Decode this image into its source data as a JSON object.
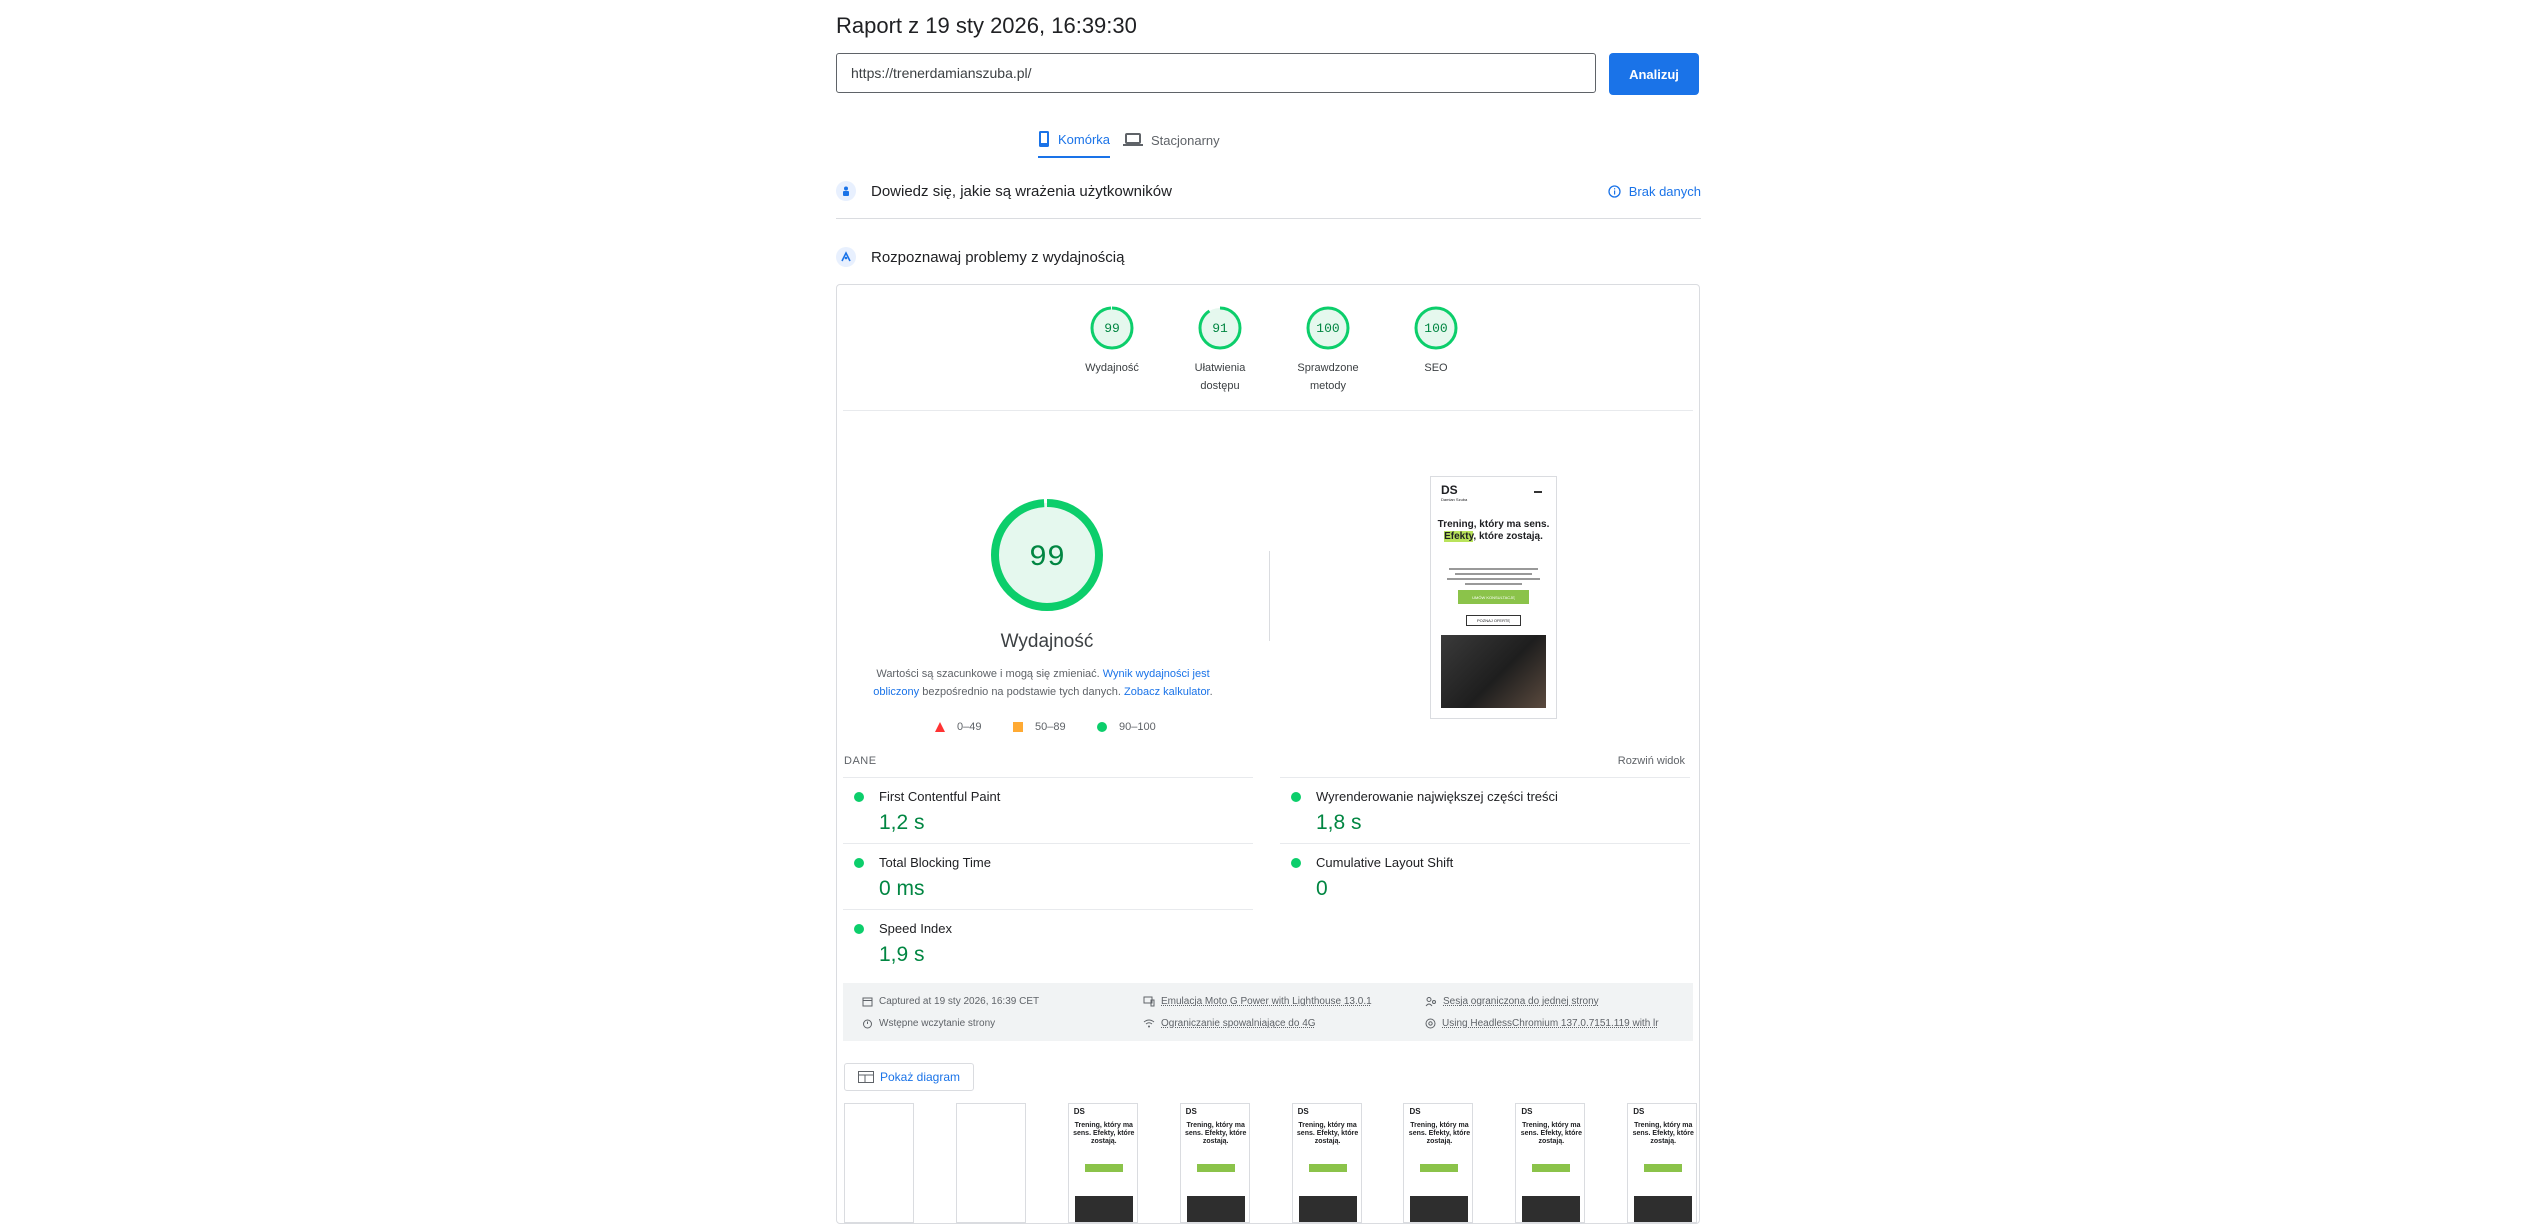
{
  "report": {
    "title": "Raport z 19 sty 2026, 16:39:30",
    "url_value": "https://trenerdamianszuba.pl/",
    "analyze_label": "Analizuj"
  },
  "tabs": [
    {
      "label": "Komórka",
      "active": true,
      "icon": "mobile-icon"
    },
    {
      "label": "Stacjonarny",
      "active": false,
      "icon": "laptop-icon"
    }
  ],
  "field_section": {
    "title": "Dowiedz się, jakie są wrażenia użytkowników",
    "no_data_label": "Brak danych"
  },
  "lab_section": {
    "title": "Rozpoznawaj problemy z wydajnością"
  },
  "scores": [
    {
      "value": 99,
      "label_line1": "Wydajność",
      "label_line2": ""
    },
    {
      "value": 91,
      "label_line1": "Ułatwienia",
      "label_line2": "dostępu"
    },
    {
      "value": 100,
      "label_line1": "Sprawdzone",
      "label_line2": "metody"
    },
    {
      "value": 100,
      "label_line1": "SEO",
      "label_line2": ""
    }
  ],
  "performance": {
    "score": 99,
    "label": "Wydajność",
    "note_before": "Wartości są szacunkowe i mogą się zmieniać. ",
    "note_link1": "Wynik wydajności jest obliczony",
    "note_middle": " bezpośrednio na podstawie tych danych. ",
    "note_link2": "Zobacz kalkulator",
    "note_end": ".",
    "legend": [
      {
        "range": "0–49",
        "color": "#ff3333",
        "shape": "triangle"
      },
      {
        "range": "50–89",
        "color": "#ffaa33",
        "shape": "square"
      },
      {
        "range": "90–100",
        "color": "#0cce6b",
        "shape": "circle"
      }
    ]
  },
  "screenshot": {
    "logo": "DS",
    "logo_sub": "Damian Szuba",
    "headline_pre": "Trening, który ma sens. ",
    "headline_highlight": "Efekty",
    "headline_post": ", które zostają.",
    "cta": "UMÓW KONSULTACJĘ",
    "secondary": "POZNAJ OFERTĘ"
  },
  "metrics": {
    "header": "DANE",
    "expand_label": "Rozwiń widok",
    "items": [
      {
        "name": "First Contentful Paint",
        "value": "1,2 s"
      },
      {
        "name": "Wyrenderowanie największej części treści",
        "value": "1,8 s"
      },
      {
        "name": "Total Blocking Time",
        "value": "0 ms"
      },
      {
        "name": "Cumulative Layout Shift",
        "value": "0"
      },
      {
        "name": "Speed Index",
        "value": "1,9 s"
      }
    ]
  },
  "run_info": {
    "captured": "Captured at 19 sty 2026, 16:39 CET",
    "load": "Wstępne wczytanie strony",
    "emulation": "Emulacja Moto G Power with Lighthouse 13.0.1",
    "throttling": "Ograniczanie spowalniające do 4G",
    "session": "Sesja ograniczona do jednej strony",
    "browser": "Using HeadlessChromium 137.0.7151.119 with lr"
  },
  "diagram_label": "Pokaż diagram",
  "filmstrip": {
    "blank_frames": 2,
    "loaded_frames": 6
  },
  "colors": {
    "accent": "#1a73e8",
    "pass": "#0cce6b",
    "pass_text": "#018642",
    "pass_bg": "#e5f8ee"
  }
}
